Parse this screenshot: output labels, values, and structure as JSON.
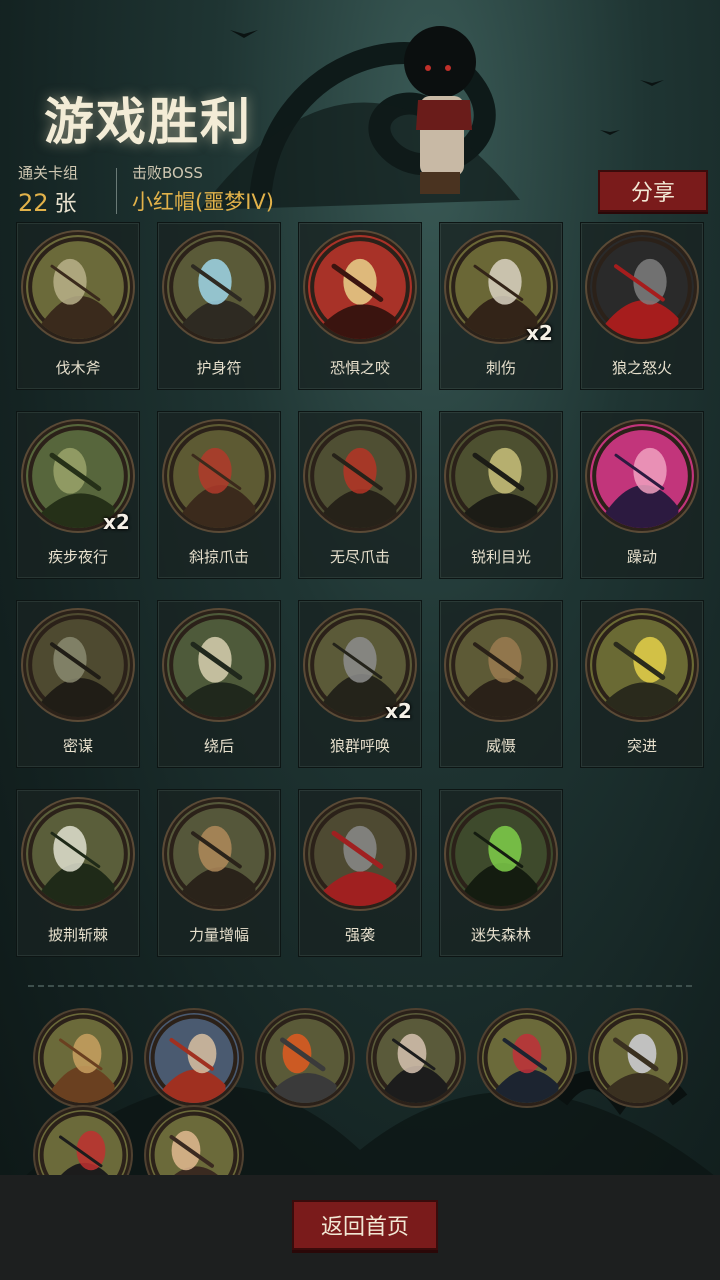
{
  "header": {
    "title": "游戏胜利",
    "cards_label": "通关卡组",
    "cards_value": "22",
    "cards_unit": "张",
    "boss_label": "击败BOSS",
    "boss_name": "小红帽(噩梦IV)",
    "share_label": "分享"
  },
  "cards": [
    {
      "label": "伐木斧",
      "icon": "axe-icon",
      "badge": ""
    },
    {
      "label": "护身符",
      "icon": "amulet-icon",
      "badge": ""
    },
    {
      "label": "恐惧之咬",
      "icon": "fear-bite-icon",
      "badge": ""
    },
    {
      "label": "刺伤",
      "icon": "dagger-icon",
      "badge": "x2"
    },
    {
      "label": "狼之怒火",
      "icon": "wolf-fury-icon",
      "badge": ""
    },
    {
      "label": "疾步夜行",
      "icon": "night-dash-icon",
      "badge": "x2"
    },
    {
      "label": "斜掠爪击",
      "icon": "slash-claw-icon",
      "badge": ""
    },
    {
      "label": "无尽爪击",
      "icon": "endless-claw-icon",
      "badge": ""
    },
    {
      "label": "锐利目光",
      "icon": "sharp-gaze-icon",
      "badge": ""
    },
    {
      "label": "躁动",
      "icon": "restless-icon",
      "badge": ""
    },
    {
      "label": "密谋",
      "icon": "conspiracy-icon",
      "badge": ""
    },
    {
      "label": "绕后",
      "icon": "flank-icon",
      "badge": ""
    },
    {
      "label": "狼群呼唤",
      "icon": "pack-call-icon",
      "badge": "x2"
    },
    {
      "label": "威慑",
      "icon": "intimidate-icon",
      "badge": ""
    },
    {
      "label": "突进",
      "icon": "charge-icon",
      "badge": ""
    },
    {
      "label": "披荆斩棘",
      "icon": "thorn-cut-icon",
      "badge": ""
    },
    {
      "label": "力量增幅",
      "icon": "power-up-icon",
      "badge": ""
    },
    {
      "label": "强袭",
      "icon": "assault-icon",
      "badge": ""
    },
    {
      "label": "迷失森林",
      "icon": "lost-forest-icon",
      "badge": ""
    }
  ],
  "relics": [
    {
      "icon": "spyglass-icon"
    },
    {
      "icon": "flag-mountain-icon"
    },
    {
      "icon": "fire-altar-icon"
    },
    {
      "icon": "vampire-icon"
    },
    {
      "icon": "book-icon"
    },
    {
      "icon": "blades-icon"
    },
    {
      "icon": "banner-skull-icon"
    },
    {
      "icon": "boy-portrait-icon"
    }
  ],
  "footer": {
    "home_label": "返回首页"
  },
  "colors": {
    "accent_red": "#7a1b1b",
    "gold": "#e2b24a",
    "card_bg": "#182221"
  }
}
